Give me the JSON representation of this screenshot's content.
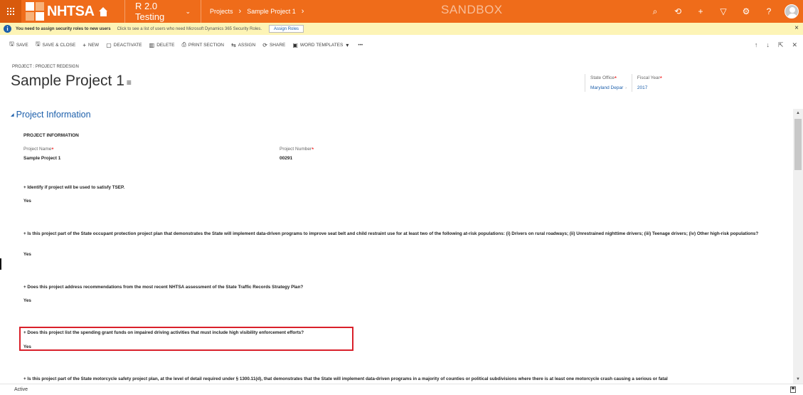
{
  "topbar": {
    "logo_text": "NHTSA",
    "app_name": "R 2.0 Testing",
    "breadcrumb": [
      "Projects",
      "Sample Project 1"
    ],
    "environment_label": "SANDBOX",
    "icons": [
      "search-icon",
      "history-icon",
      "plus-icon",
      "filter-icon",
      "gear-icon",
      "help-icon",
      "user-avatar"
    ]
  },
  "notification": {
    "bold_text": "You need to assign security roles to new users",
    "text": "Click to see a list of users who need Microsoft Dynamics 365 Security Roles.",
    "button_label": "Assign Roles",
    "close_glyph": "×"
  },
  "command_bar": {
    "save": "SAVE",
    "save_close": "SAVE & CLOSE",
    "new": "NEW",
    "deactivate": "DEACTIVATE",
    "delete": "DELETE",
    "print_section": "PRINT SECTION",
    "assign": "ASSIGN",
    "share": "SHARE",
    "word_templates": "WORD TEMPLATES",
    "more": "•••"
  },
  "header": {
    "entity_breadcrumb": "PROJECT : PROJECT REDESIGN",
    "title": "Sample Project 1",
    "state_office_label": "State Office",
    "state_office_value": "Maryland Depar",
    "fiscal_year_label": "Fiscal Year",
    "fiscal_year_value": "2017"
  },
  "section": {
    "title": "Project Information",
    "sub_heading": "PROJECT INFORMATION",
    "project_name_label": "Project Name",
    "project_name_value": "Sample Project 1",
    "project_number_label": "Project Number",
    "project_number_value": "00291",
    "questions": [
      {
        "q": "+ Identify if project will be used to satisfy TSEP.",
        "a": "Yes"
      },
      {
        "q": "+ Is this project part of the State occupant protection project plan that demonstrates the State will implement data-driven programs to improve seat belt and child restraint use for at least two of the following at-risk populations: (i) Drivers on rural roadways; (ii) Unrestrained nighttime drivers; (iii) Teenage drivers; (iv) Other high-risk populations?",
        "a": "Yes"
      },
      {
        "q": "+ Does this project address recommendations from the most recent NHTSA assessment of the State Traffic Records Strategy Plan?",
        "a": "Yes"
      },
      {
        "q": "+ Does this project list the spending grant funds on impaired driving activities that must include high visibility enforcement efforts?",
        "a": "Yes"
      },
      {
        "q": "+ Is this project part of the State motorcycle safety project plan, at the level of detail required under § 1300.11(d), that demonstrates that the State will implement data-driven programs in a majority of counties or political subdivisions where there is at least one motorcycle crash causing a serious or fatal",
        "a": ""
      }
    ]
  },
  "status": {
    "label": "Active"
  },
  "colors": {
    "brand_orange": "#ef6c1a",
    "link_blue": "#1c5fab",
    "highlight_red": "#d9202a",
    "notification_yellow": "#fdf4b6"
  }
}
